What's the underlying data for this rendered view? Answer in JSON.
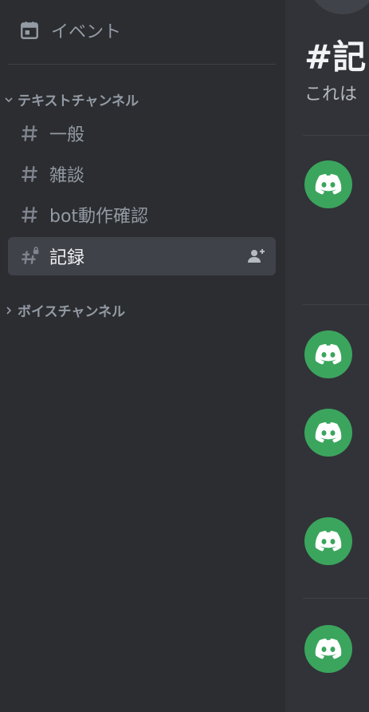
{
  "sidebar": {
    "events_label": "イベント",
    "categories": [
      {
        "label": "テキストチャンネル",
        "expanded": true
      },
      {
        "label": "ボイスチャンネル",
        "expanded": false
      }
    ],
    "channels": [
      {
        "name": "一般",
        "active": false,
        "locked": false
      },
      {
        "name": "雑談",
        "active": false,
        "locked": false
      },
      {
        "name": "bot動作確認",
        "active": false,
        "locked": false
      },
      {
        "name": "記録",
        "active": true,
        "locked": true
      }
    ]
  },
  "main": {
    "title": "#記",
    "subtitle": "これは",
    "avatars": [
      "discord-logo",
      "discord-logo",
      "discord-logo",
      "discord-logo",
      "discord-logo"
    ]
  },
  "colors": {
    "sidebar_bg": "#2b2d31",
    "main_bg": "#313338",
    "active_channel_bg": "#404249",
    "avatar_green": "#3ba55d",
    "muted_text": "#949ba4"
  }
}
